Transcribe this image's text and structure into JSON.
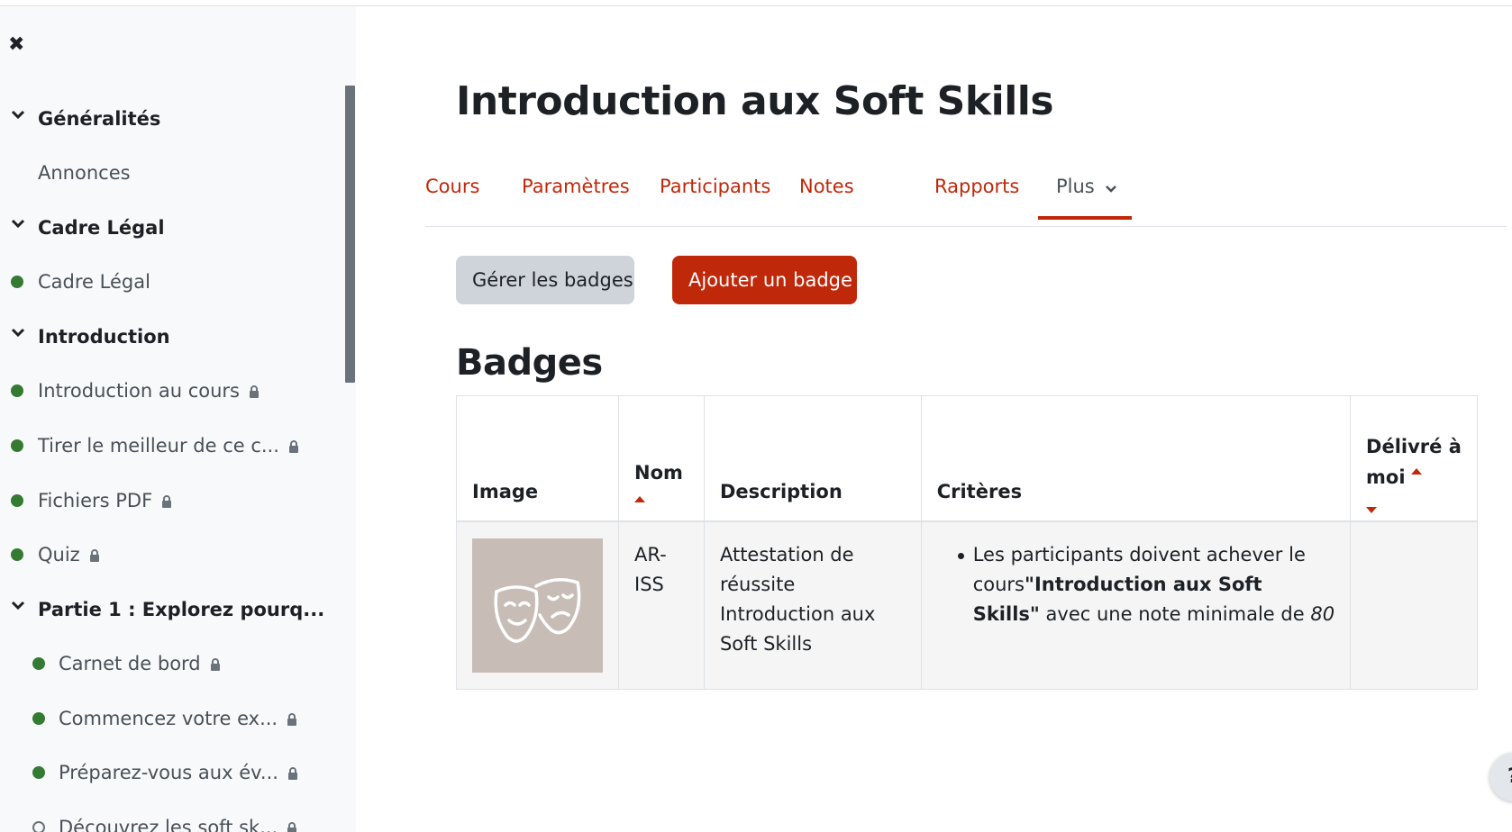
{
  "sidebar": {
    "close_icon": "close-icon",
    "items": [
      {
        "type": "section",
        "label": "Généralités"
      },
      {
        "type": "link",
        "label": "Annonces",
        "status": "none",
        "locked": false
      },
      {
        "type": "section",
        "label": "Cadre Légal"
      },
      {
        "type": "link",
        "label": "Cadre Légal",
        "status": "complete",
        "locked": false
      },
      {
        "type": "section",
        "label": "Introduction"
      },
      {
        "type": "link",
        "label": "Introduction au cours",
        "status": "complete",
        "locked": true
      },
      {
        "type": "link",
        "label": "Tirer le meilleur de ce c...",
        "status": "complete",
        "locked": true
      },
      {
        "type": "link",
        "label": "Fichiers PDF",
        "status": "complete",
        "locked": true
      },
      {
        "type": "link",
        "label": "Quiz",
        "status": "complete",
        "locked": true
      },
      {
        "type": "section",
        "label": "Partie 1 : Explorez pourq..."
      },
      {
        "type": "link",
        "label": "Carnet de bord",
        "status": "complete",
        "locked": true
      },
      {
        "type": "link",
        "label": "Commencez votre ex...",
        "status": "complete",
        "locked": true
      },
      {
        "type": "link",
        "label": "Préparez-vous aux év...",
        "status": "complete",
        "locked": true
      },
      {
        "type": "link",
        "label": "Découvrez les soft sk...",
        "status": "incomplete",
        "locked": true
      }
    ]
  },
  "header": {
    "title": "Introduction aux Soft Skills"
  },
  "tabs": [
    {
      "label": "Cours"
    },
    {
      "label": "Paramètres"
    },
    {
      "label": "Participants"
    },
    {
      "label": "Notes"
    },
    {
      "label": "Rapports"
    },
    {
      "label": "Plus",
      "active": true
    }
  ],
  "actions": {
    "manage_label": "Gérer les badges",
    "add_label": "Ajouter un badge"
  },
  "badges_section": {
    "title": "Badges",
    "columns": {
      "image": "Image",
      "name": "Nom",
      "description": "Description",
      "criteria": "Critères",
      "issued_line1": "Délivré à",
      "issued_line2": "moi"
    },
    "rows": [
      {
        "image_icon": "theater-masks-icon",
        "name_line1": "AR-",
        "name_line2": "ISS",
        "description": "Attestation de réussite Introduction aux Soft Skills",
        "criteria_prefix": "Les participants doivent achever le cours",
        "criteria_course": "\"Introduction aux Soft Skills\"",
        "criteria_suffix": "avec une note minimale de",
        "criteria_grade": "80",
        "issued": ""
      }
    ]
  },
  "help_button": {
    "label": "?"
  },
  "colors": {
    "accent": "#c0280a",
    "complete_dot": "#357a32",
    "sidebar_bg": "#f8f9fa",
    "badge_bg": "#c8bdb6"
  }
}
